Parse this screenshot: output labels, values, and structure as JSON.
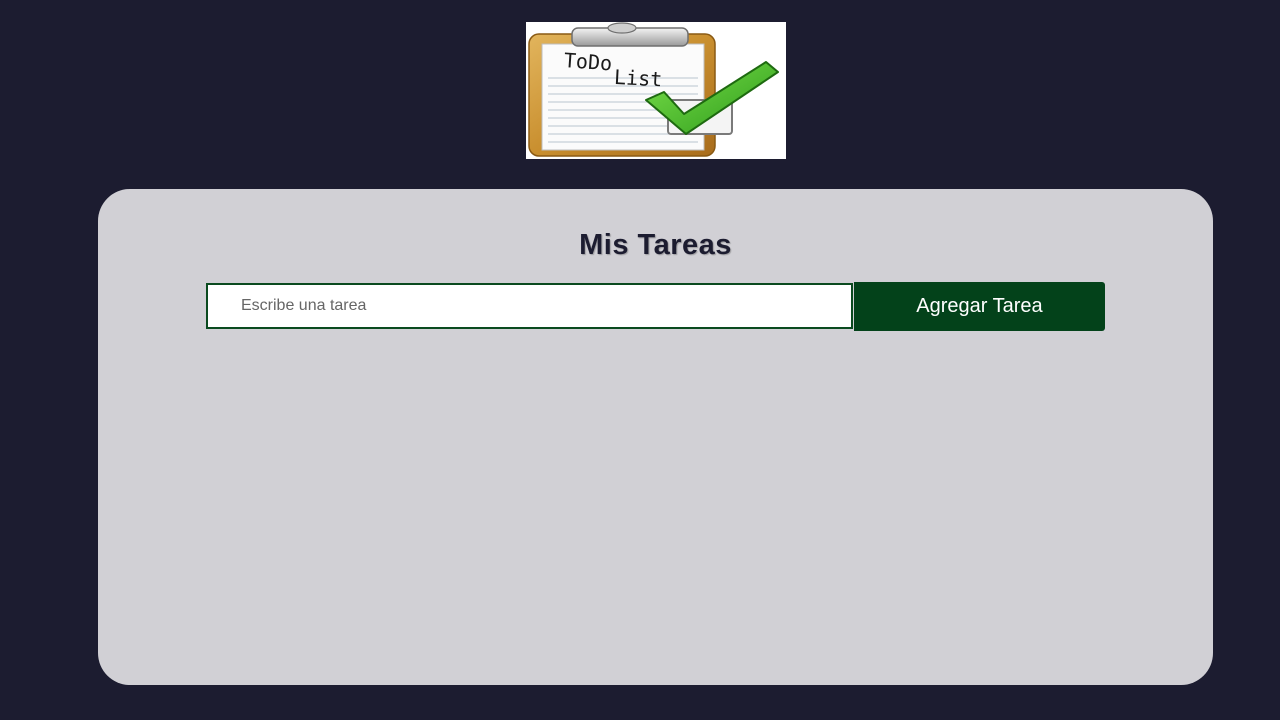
{
  "logo": {
    "alt": "ToDo List",
    "text_line1": "ToDo",
    "text_line2": "List",
    "icon": "clipboard-checkmark-icon"
  },
  "main": {
    "title": "Mis Tareas",
    "input_placeholder": "Escribe una tarea",
    "input_value": "",
    "add_button_label": "Agregar Tarea",
    "tasks": []
  },
  "colors": {
    "page_background": "#1c1c30",
    "card_background": "#d1d0d5",
    "accent_green": "#03421a",
    "title_color": "#1c1c30"
  }
}
